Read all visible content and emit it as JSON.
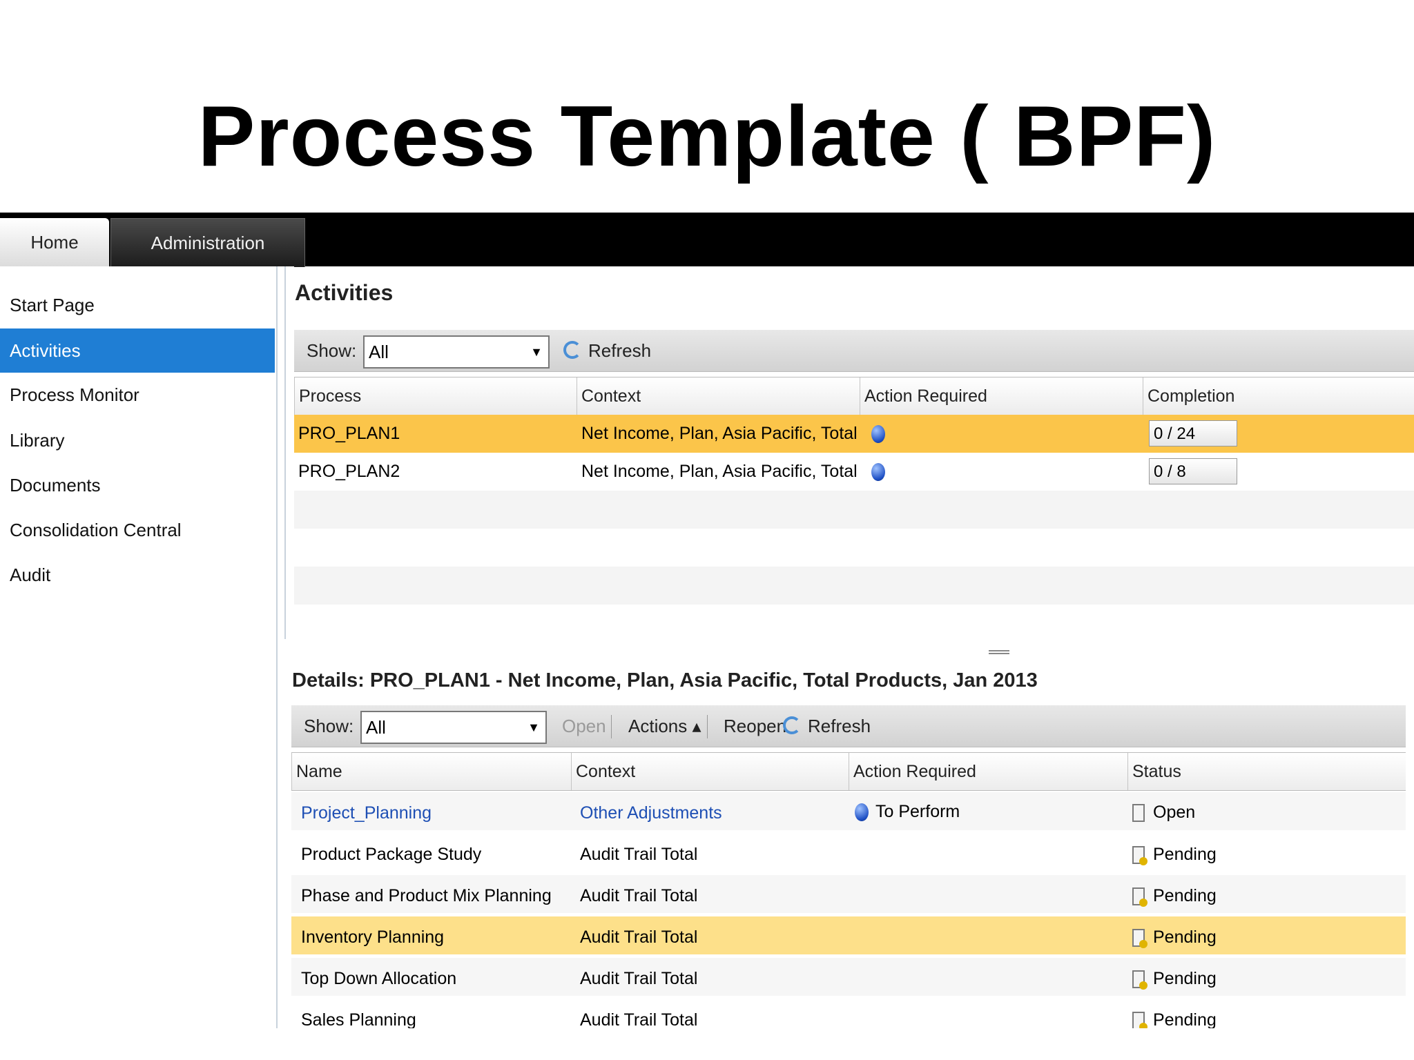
{
  "slide": {
    "title": "Process Template ( BPF)"
  },
  "tabs": [
    {
      "label": "Home",
      "active": true
    },
    {
      "label": "Administration",
      "active": false
    }
  ],
  "sidebar": {
    "items": [
      {
        "label": "Start Page"
      },
      {
        "label": "Activities",
        "active": true
      },
      {
        "label": "Process Monitor"
      },
      {
        "label": "Library"
      },
      {
        "label": "Documents"
      },
      {
        "label": "Consolidation Central"
      },
      {
        "label": "Audit"
      }
    ]
  },
  "activities": {
    "heading": "Activities",
    "toolbar": {
      "show_label": "Show:",
      "show_value": "All",
      "refresh_label": "Refresh"
    },
    "columns": [
      "Process",
      "Context",
      "Action Required",
      "Completion"
    ],
    "rows": [
      {
        "process": "PRO_PLAN1",
        "context": "Net Income, Plan, Asia Pacific, Total Produ...",
        "completion": "0 / 24",
        "selected": true
      },
      {
        "process": "PRO_PLAN2",
        "context": "Net Income, Plan, Asia Pacific, Total Produ...",
        "completion": "0 / 8",
        "selected": false
      }
    ]
  },
  "details": {
    "heading": "Details: PRO_PLAN1 - Net Income, Plan, Asia Pacific, Total Products, Jan 2013",
    "toolbar": {
      "show_label": "Show:",
      "show_value": "All",
      "open_label": "Open",
      "actions_label": "Actions ▴",
      "reopen_label": "Reopen",
      "refresh_label": "Refresh"
    },
    "columns": [
      "Name",
      "Context",
      "Action Required",
      "Status"
    ],
    "rows": [
      {
        "name": "Project_Planning",
        "context": "Other Adjustments",
        "action": "To Perform",
        "status": "Open"
      },
      {
        "name": "Product Package Study",
        "context": "Audit Trail Total",
        "action": "",
        "status": "Pending"
      },
      {
        "name": "Phase and Product Mix Planning",
        "context": "Audit Trail Total",
        "action": "",
        "status": "Pending"
      },
      {
        "name": "Inventory Planning",
        "context": "Audit Trail Total",
        "action": "",
        "status": "Pending"
      },
      {
        "name": "Top Down Allocation",
        "context": "Audit Trail Total",
        "action": "",
        "status": "Pending"
      },
      {
        "name": "Sales Planning",
        "context": "Audit Trail Total",
        "action": "",
        "status": "Pending"
      }
    ]
  },
  "colors": {
    "accent": "#1f7ed4",
    "selected_row": "#fbc54a",
    "highlight_row": "#fde08a",
    "link": "#1e4fb4"
  }
}
